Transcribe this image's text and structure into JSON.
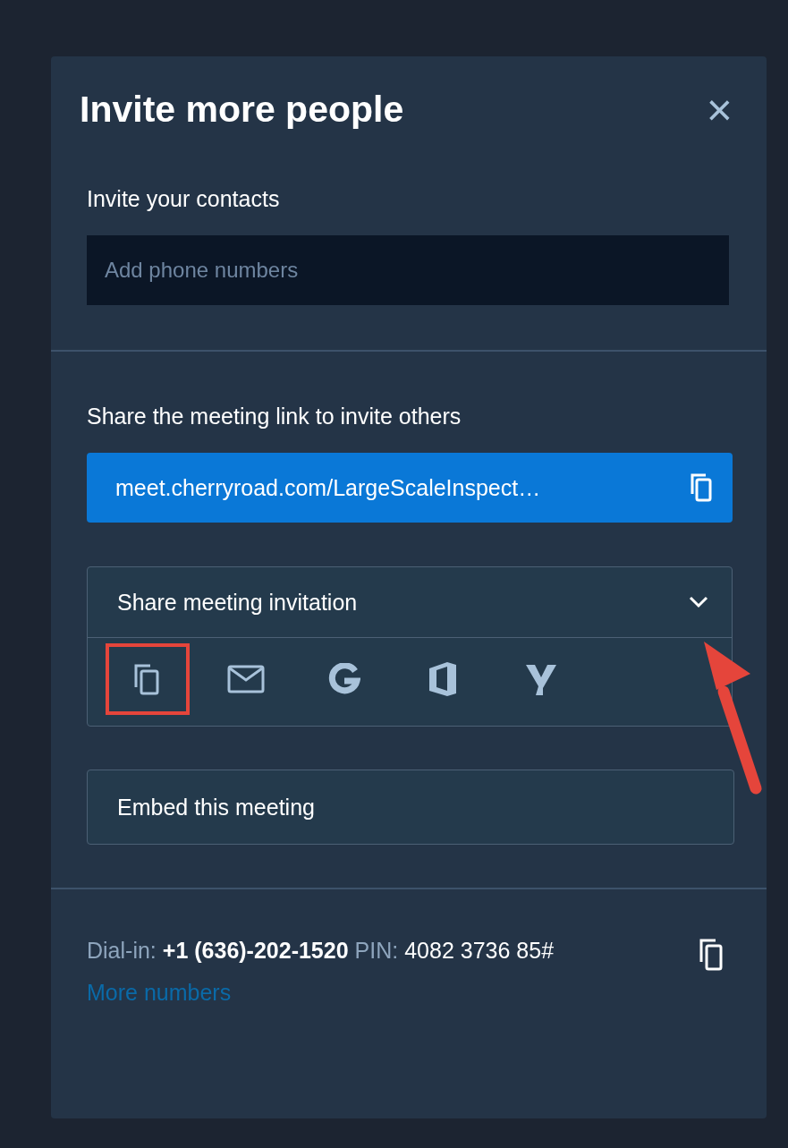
{
  "dialog": {
    "title": "Invite more people",
    "close": "×"
  },
  "contacts": {
    "label": "Invite your contacts",
    "placeholder": "Add phone numbers"
  },
  "share_link": {
    "label": "Share the meeting link to invite others",
    "link": "meet.cherryroad.com/LargeScaleInspect…"
  },
  "invitation": {
    "title": "Share meeting invitation",
    "expanded": true,
    "options": [
      {
        "kind": "copy",
        "highlighted": true
      },
      {
        "kind": "email",
        "highlighted": false
      },
      {
        "kind": "google",
        "highlighted": false
      },
      {
        "kind": "office",
        "highlighted": false
      },
      {
        "kind": "yahoo",
        "highlighted": false
      }
    ]
  },
  "embed": {
    "label": "Embed this meeting"
  },
  "dial_in": {
    "label": "Dial-in:",
    "number": "+1 (636)-202-1520",
    "pin_label": "PIN:",
    "pin": "4082 3736 85#",
    "more": "More numbers"
  }
}
